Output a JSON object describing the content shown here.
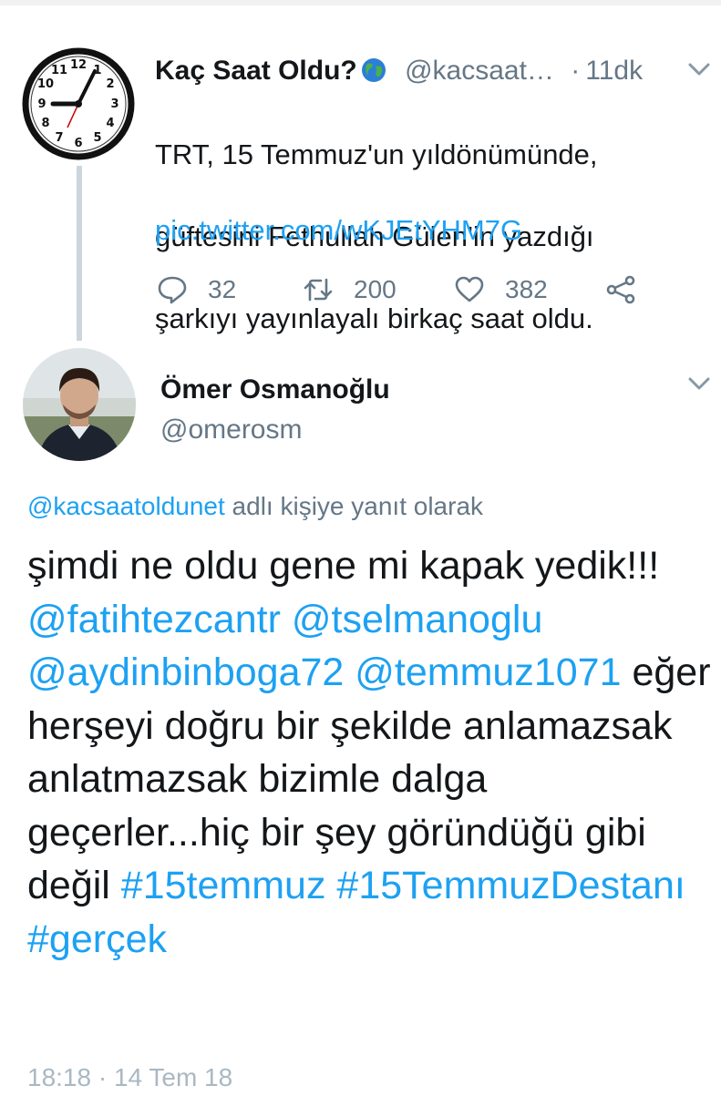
{
  "tweet1": {
    "display_name": "Kaç Saat Oldu?",
    "handle": "@kacsaat…",
    "separator": "·",
    "time": "11dk",
    "text_lines": [
      "TRT, 15 Temmuz'un yıldönümünde,",
      "güftesini Fethullah Gülen'in yazdığı",
      "şarkıyı yayınlayalı birkaç saat oldu."
    ],
    "link": "pic.twitter.com/wKJEtYHM7G",
    "actions": {
      "reply_count": "32",
      "retweet_count": "200",
      "like_count": "382"
    },
    "icons": {
      "avatar": "clock-avatar",
      "badge": "globe-icon",
      "menu": "chevron-down-icon",
      "reply": "reply-icon",
      "retweet": "retweet-icon",
      "like": "heart-icon",
      "share": "share-icon"
    }
  },
  "tweet2": {
    "display_name": "Ömer Osmanoğlu",
    "handle": "@omerosm",
    "reply_to": {
      "mention": "@kacsaatoldunet",
      "suffix": " adlı kişiye yanıt olarak"
    },
    "body": {
      "s1": "şimdi ne oldu gene mi kapak yedik!!! ",
      "m1": "@fatihtezcantr",
      "m2": "@tselmanoglu",
      "m3": "@aydinbinboga72",
      "m4": "@temmuz1071",
      "s2": " eğer herşeyi doğru bir şekilde anlamazsak anlatmazsak  bizimle dalga geçerler...hiç bir şey göründüğü gibi değil ",
      "h1": "#15temmuz",
      "h2": "#15TemmuzDestanı",
      "h3": "#gerçek"
    },
    "timestamp_partial": "18:18 · 14 Tem 18"
  },
  "colors": {
    "link": "#1da1f2",
    "secondary_text": "#657786",
    "primary_text": "#14171a",
    "thread_line": "#ccd6dd"
  }
}
